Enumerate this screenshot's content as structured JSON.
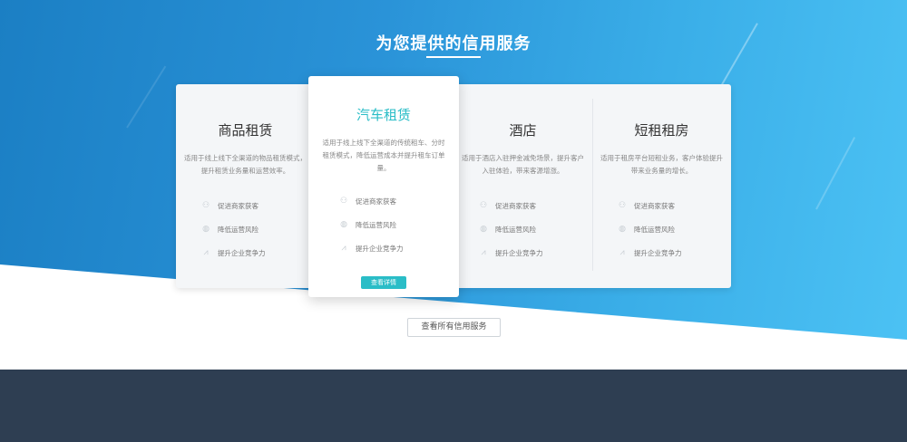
{
  "section": {
    "title": "为您提供的信用服务"
  },
  "cards": [
    {
      "title": "商品租赁",
      "desc": "适用于线上线下全渠道的物品租赁模式，提升租赁业务量和运营效率。",
      "features": [
        {
          "icon": "merchant-icon",
          "label": "促进商家获客"
        },
        {
          "icon": "shield-icon",
          "label": "降低运营风险"
        },
        {
          "icon": "growth-chart-icon",
          "label": "提升企业竞争力"
        }
      ]
    },
    {
      "title": "汽车租赁",
      "desc": "适用于线上线下全渠道的传统租车、分时租赁模式，降低运营成本并提升租车订单量。",
      "features": [
        {
          "icon": "merchant-icon",
          "label": "促进商家获客"
        },
        {
          "icon": "shield-icon",
          "label": "降低运营风险"
        },
        {
          "icon": "growth-chart-icon",
          "label": "提升企业竞争力"
        }
      ],
      "button": "查看详情"
    },
    {
      "title": "酒店",
      "desc": "适用于酒店入驻押金减免场景，提升客户入驻体验，带来客源增涨。",
      "features": [
        {
          "icon": "merchant-icon",
          "label": "促进商家获客"
        },
        {
          "icon": "shield-icon",
          "label": "降低运营风险"
        },
        {
          "icon": "growth-chart-icon",
          "label": "提升企业竞争力"
        }
      ]
    },
    {
      "title": "短租租房",
      "desc": "适用于租房平台短租业务，客户体验提升带来业务量的增长。",
      "features": [
        {
          "icon": "merchant-icon",
          "label": "促进商家获客"
        },
        {
          "icon": "shield-icon",
          "label": "降低运营风险"
        },
        {
          "icon": "growth-chart-icon",
          "label": "提升企业竞争力"
        }
      ]
    }
  ],
  "all_services_button": "查看所有信用服务",
  "colors": {
    "accent": "#2abdc7",
    "hero_start": "#1b7fc4",
    "hero_end": "#4cc2f4",
    "footer": "#2e3e52"
  }
}
